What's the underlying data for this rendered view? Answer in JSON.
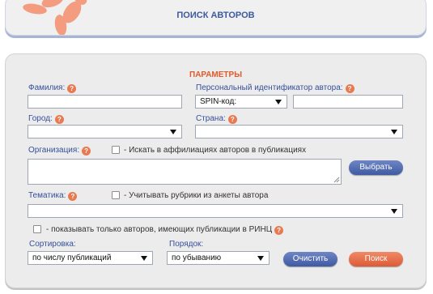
{
  "header": {
    "title": "ПОИСК АВТОРОВ"
  },
  "params": {
    "title": "ПАРАМЕТРЫ",
    "surname_label": "Фамилия:",
    "author_id_label": "Персональный идентификатор автора:",
    "id_type_selected": "SPIN-код:",
    "city_label": "Город:",
    "country_label": "Страна:",
    "organization_label": "Организация:",
    "affiliations_checkbox_label": "- Искать в аффилиациях авторов в публикациях",
    "choose_button": "Выбрать",
    "topic_label": "Тематика:",
    "rubrics_checkbox_label": "- Учитывать рубрики из анкеты автора",
    "rinc_checkbox_label": "- показывать только авторов, имеющих публикации в РИНЦ",
    "sort_label": "Сортировка:",
    "sort_selected": "по числу публикаций",
    "order_label": "Порядок:",
    "order_selected": "по убыванию",
    "clear_button": "Очистить",
    "search_button": "Поиск",
    "help_mark": "?"
  },
  "colors": {
    "label_blue": "#35509a",
    "title_orange": "#e05a2a",
    "button_blue": "#3f5aa3",
    "button_orange": "#dd5a36",
    "help_icon": "#e87a52"
  }
}
